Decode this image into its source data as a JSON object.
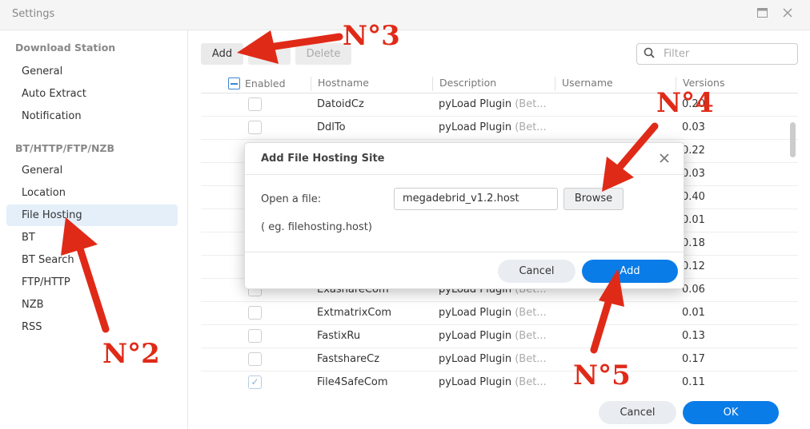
{
  "window": {
    "title": "Settings",
    "maximize_icon": "maximize-icon",
    "close_icon": "close-icon"
  },
  "sidebar": {
    "sections": [
      {
        "header": "Download Station",
        "items": [
          "General",
          "Auto Extract",
          "Notification"
        ]
      },
      {
        "header": "BT/HTTP/FTP/NZB",
        "items": [
          "General",
          "Location",
          "File Hosting",
          "BT",
          "BT Search",
          "FTP/HTTP",
          "NZB",
          "RSS"
        ]
      }
    ],
    "active_item": "File Hosting"
  },
  "toolbar": {
    "add_label": "Add",
    "delete_label": "Delete",
    "filter_placeholder": "Filter"
  },
  "table": {
    "columns": [
      "Enabled",
      "Hostname",
      "Description",
      "Username",
      "Versions"
    ],
    "rows": [
      {
        "enabled": false,
        "hostname": "DatoidCz",
        "description": "pyLoad Plugin",
        "desc_suffix": "(Bet...",
        "version": "0.20"
      },
      {
        "enabled": false,
        "hostname": "DdlTo",
        "description": "pyLoad Plugin",
        "desc_suffix": "(Bet...",
        "version": "0.03"
      },
      {
        "enabled": false,
        "hostname": "",
        "description": "",
        "desc_suffix": "",
        "version": "0.22"
      },
      {
        "enabled": false,
        "hostname": "",
        "description": "",
        "desc_suffix": "",
        "version": "0.03"
      },
      {
        "enabled": false,
        "hostname": "",
        "description": "",
        "desc_suffix": "",
        "version": "0.40"
      },
      {
        "enabled": false,
        "hostname": "",
        "description": "",
        "desc_suffix": "",
        "version": "0.01"
      },
      {
        "enabled": false,
        "hostname": "",
        "description": "",
        "desc_suffix": "",
        "version": "0.18"
      },
      {
        "enabled": false,
        "hostname": "",
        "description": "",
        "desc_suffix": "",
        "version": "0.12"
      },
      {
        "enabled": false,
        "hostname": "ExashareCom",
        "description": "pyLoad Plugin",
        "desc_suffix": "(Bet...",
        "version": "0.06"
      },
      {
        "enabled": false,
        "hostname": "ExtmatrixCom",
        "description": "pyLoad Plugin",
        "desc_suffix": "(Bet...",
        "version": "0.01"
      },
      {
        "enabled": false,
        "hostname": "FastixRu",
        "description": "pyLoad Plugin",
        "desc_suffix": "(Bet...",
        "version": "0.13"
      },
      {
        "enabled": false,
        "hostname": "FastshareCz",
        "description": "pyLoad Plugin",
        "desc_suffix": "(Bet...",
        "version": "0.17"
      },
      {
        "enabled": true,
        "hostname": "File4SafeCom",
        "description": "pyLoad Plugin",
        "desc_suffix": "(Bet...",
        "version": "0.11"
      }
    ]
  },
  "footer": {
    "cancel_label": "Cancel",
    "ok_label": "OK"
  },
  "dialog": {
    "title": "Add File Hosting Site",
    "open_label": "Open a file:",
    "file_value": "megadebrid_v1.2.host",
    "browse_label": "Browse",
    "hint": "( eg. filehosting.host)",
    "cancel_label": "Cancel",
    "add_label": "Add"
  },
  "annotations": {
    "color": "#e02a18",
    "labels": [
      "N°2",
      "N°3",
      "N°4",
      "N°5"
    ]
  }
}
